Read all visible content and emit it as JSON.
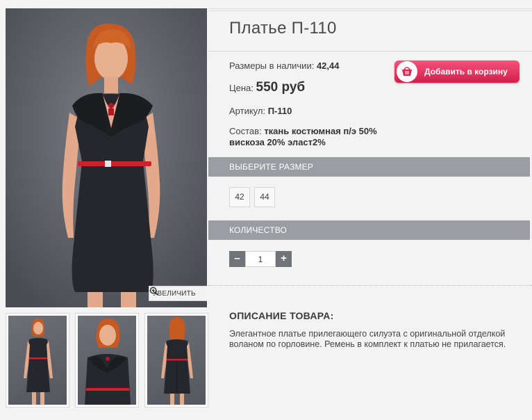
{
  "product": {
    "title": "Платье П-110",
    "sizes_label": "Размеры в наличии:",
    "sizes_value": "42,44",
    "price_label": "Цена:",
    "price_value": "550 руб",
    "article_label": "Артикул:",
    "article_value": "П-110",
    "composition_label": "Состав:",
    "composition_line1": "ткань костюмная п/э 50%",
    "composition_line2": "вискоза 20% эласт2%"
  },
  "cart_button": {
    "label": "Добавить в корзину",
    "icon": "basket-icon",
    "color": "#e0224f"
  },
  "gallery": {
    "zoom_label": "УВЕЛИЧИТЬ",
    "zoom_icon": "magnifier-plus-icon",
    "thumb_count": 3
  },
  "size_section": {
    "header": "ВЫБЕРИТЕ РАЗМЕР",
    "options": [
      "42",
      "44"
    ]
  },
  "quantity_section": {
    "header": "КОЛИЧЕСТВО",
    "minus": "–",
    "plus": "+",
    "value": "1"
  },
  "description": {
    "header": "ОПИСАНИЕ ТОВАРА:",
    "text": "Элегантное платье прилегающего силуэта с оригинальной отделкой воланом по горловине. Ремень в комплект к платью не прилагается."
  },
  "colors": {
    "bar_bg": "#9a9ea3",
    "accent": "#e0224f",
    "belt": "#d0202a",
    "dress": "#26272c"
  }
}
